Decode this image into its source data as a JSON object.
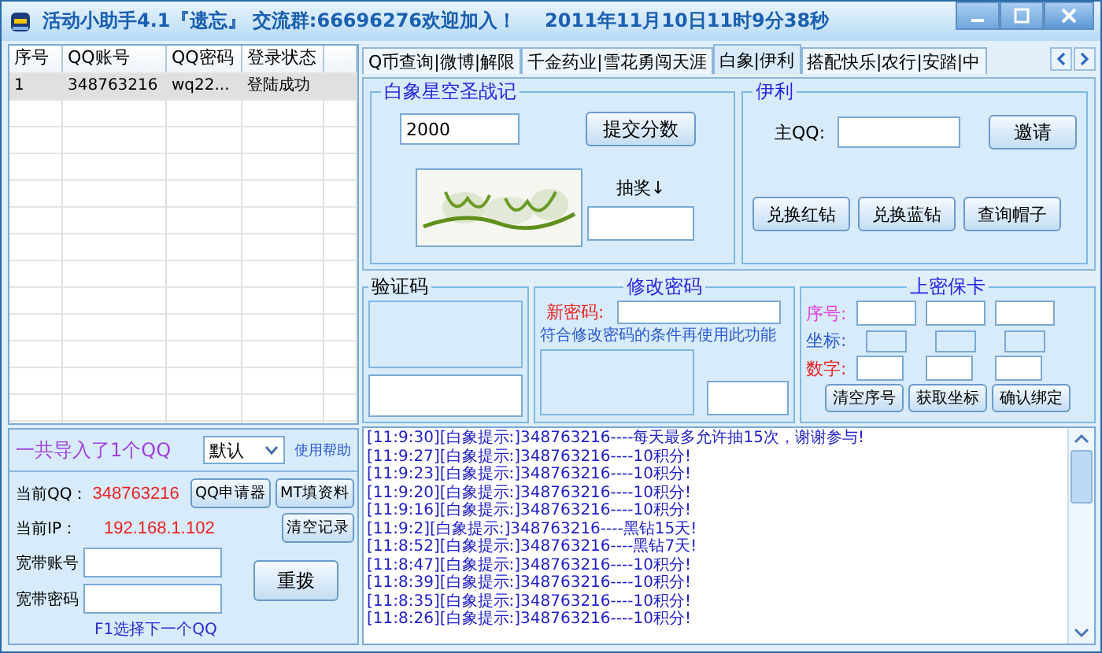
{
  "window": {
    "title": "活动小助手4.1『遗忘』 交流群:66696276欢迎加入！",
    "datetime": "2011年11月10日11时9分38秒"
  },
  "accounts_table": {
    "columns": [
      "序号",
      "QQ账号",
      "QQ密码",
      "登录状态"
    ],
    "rows": [
      {
        "cells": [
          "1",
          "348763216",
          "wq22...",
          "登陆成功"
        ],
        "selected": true
      }
    ]
  },
  "import_panel": {
    "summary": "一共导入了1个QQ",
    "mode_select": "默认",
    "help_link": "使用帮助"
  },
  "account_panel": {
    "current_qq_label": "当前QQ：",
    "current_qq": "348763216",
    "current_ip_label": "当前IP：",
    "current_ip": "192.168.1.102",
    "broadband_account_label": "宽带账号",
    "broadband_password_label": "宽带密码",
    "hint": "F1选择下一个QQ",
    "buttons": [
      "QQ申请器",
      "MT填资料",
      "清空记录",
      "重拨"
    ]
  },
  "tabs": [
    {
      "label": "Q币查询|微博|解限",
      "selected": false
    },
    {
      "label": "千金药业|雪花勇闯天涯",
      "selected": false
    },
    {
      "label": "白象|伊利",
      "selected": true
    },
    {
      "label": "搭配快乐|农行|安踏|中",
      "selected": false
    }
  ],
  "baixiang": {
    "title": "白象星空圣战记",
    "score": "2000",
    "submit_button": "提交分数",
    "lottery_label": "抽奖↓"
  },
  "yili": {
    "title": "伊利",
    "main_qq_label": "主QQ:",
    "invite_button": "邀请",
    "buttons": [
      "兑换红钻",
      "兑换蓝钻",
      "查询帽子"
    ]
  },
  "captcha": {
    "title": "验证码"
  },
  "change_password": {
    "title": "修改密码",
    "new_password_label": "新密码:",
    "note": "符合修改密码的条件再使用此功能"
  },
  "security_card": {
    "title": "上密保卡",
    "serial_label": "序号:",
    "coord_label": "坐标:",
    "digits_label": "数字:",
    "buttons": [
      "清空序号",
      "获取坐标",
      "确认绑定"
    ]
  },
  "log": [
    "[11:9:30][白象提示:]348763216----每天最多允许抽15次，谢谢参与!",
    "[11:9:27][白象提示:]348763216----10积分!",
    "[11:9:23][白象提示:]348763216----10积分!",
    "[11:9:20][白象提示:]348763216----10积分!",
    "[11:9:16][白象提示:]348763216----10积分!",
    "[11:9:2][白象提示:]348763216----黑钻15天!",
    "[11:8:52][白象提示:]348763216----黑钻7天!",
    "[11:8:47][白象提示:]348763216----10积分!",
    "[11:8:39][白象提示:]348763216----10积分!",
    "[11:8:35][白象提示:]348763216----10积分!",
    "[11:8:26][白象提示:]348763216----10积分!"
  ]
}
